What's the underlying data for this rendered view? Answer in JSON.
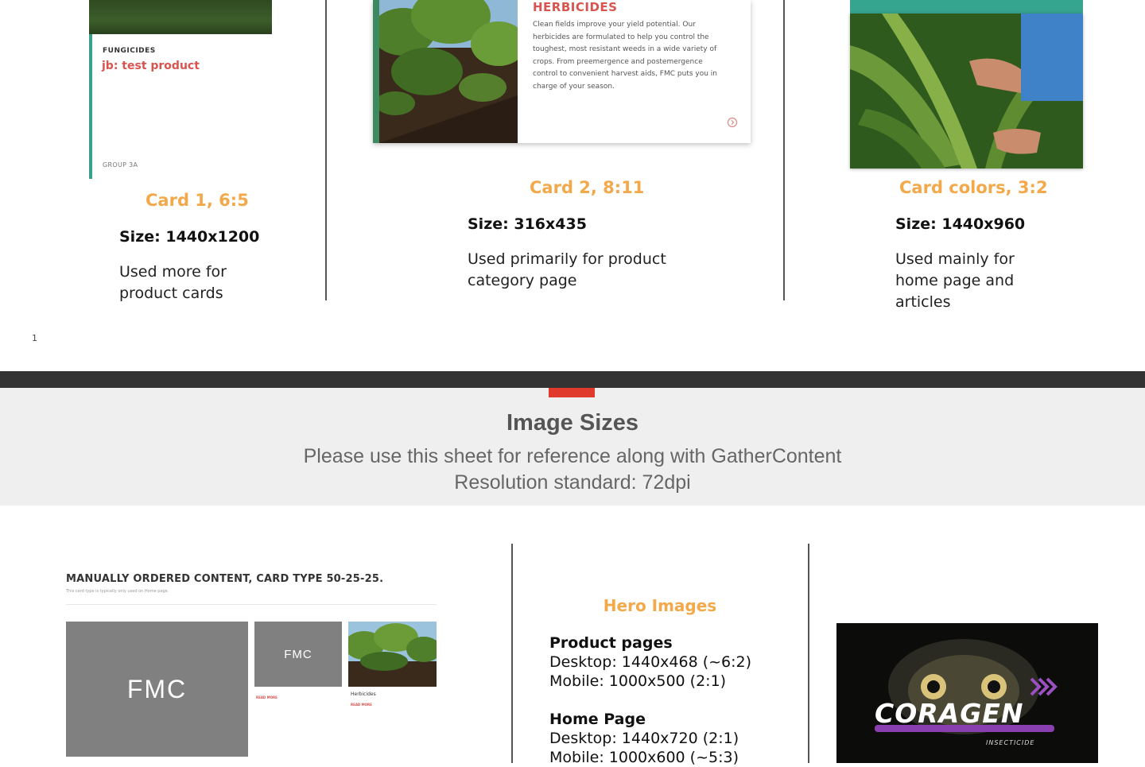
{
  "cards": [
    {
      "title": "Card 1, 6:5",
      "size": "Size: 1440x1200",
      "desc_lines": [
        "Used more for",
        "product cards"
      ],
      "preview": {
        "category": "FUNGICIDES",
        "name": "jb: test product",
        "group": "GROUP 3A"
      }
    },
    {
      "title": "Card 2, 8:11",
      "size": "Size: 316x435",
      "desc_lines": [
        "Used primarily for product",
        "category page"
      ],
      "preview": {
        "heading": "HERBICIDES",
        "body_lines": [
          "Clean fields improve your yield potential. Our",
          "herbicides are formulated to help you control the",
          "toughest, most resistant weeds in a wide variety of",
          "crops. From preemergence and postemergence",
          "control to convenient harvest aids, FMC puts you in",
          "charge of your season."
        ],
        "arrow_icon": "arrow-circle-icon"
      }
    },
    {
      "title": "Card colors, 3:2",
      "size": "Size: 1440x960",
      "desc_lines": [
        "Used mainly for",
        "home page and",
        "articles"
      ]
    }
  ],
  "page_number": "1",
  "header": {
    "title": "Image Sizes",
    "subtitle_lines": [
      "Please use this sheet for reference along with GatherContent",
      "Resolution standard: 72dpi"
    ]
  },
  "mockup": {
    "title": "MANUALLY ORDERED CONTENT, CARD TYPE 50-25-25.",
    "subtitle": "This card type is typically only used on Home page.",
    "logo_text": "FMC",
    "read_more": "READ MORE",
    "mini_category": "Herbicides"
  },
  "hero": {
    "title": "Hero Images",
    "groups": [
      {
        "heading": "Product pages",
        "lines": [
          "Desktop: 1440x468 (~6:2)",
          "Mobile: 1000x500 (2:1)"
        ]
      },
      {
        "heading": "Home Page",
        "lines": [
          "Desktop: 1440x720 (2:1)",
          "Mobile: 1000x600 (~5:3)"
        ]
      }
    ]
  },
  "coragen": {
    "brand": "CORAGEN",
    "tagline": "INSECTICIDE"
  },
  "colors": {
    "accent_orange": "#f3a94a",
    "brand_red": "#e03a2c",
    "teal": "#35a58f",
    "product_red": "#d9534f"
  }
}
